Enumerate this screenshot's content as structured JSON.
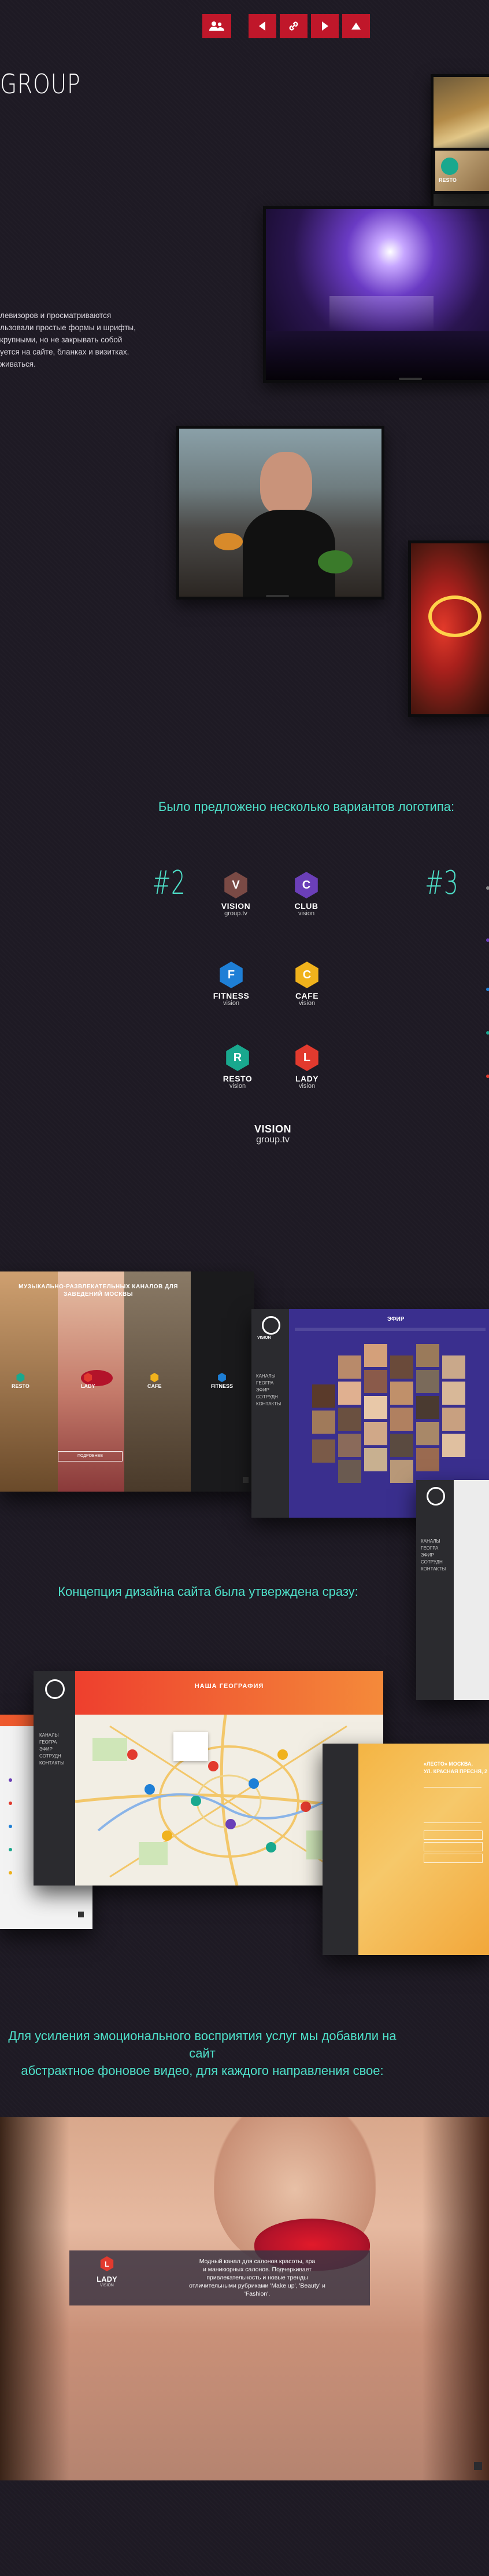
{
  "toolbar": {
    "people_icon": "people-icon",
    "prev_icon": "arrow-left-icon",
    "link_icon": "link-icon",
    "next_icon": "arrow-right-icon",
    "up_icon": "arrow-up-icon"
  },
  "header": {
    "brand": "GROUP"
  },
  "intro": {
    "lines": [
      "левизоров и просматриваются",
      "льзовали простые формы и шрифты,",
      "крупными, но не закрывать собой",
      "уется на сайте, бланках и визитках.",
      "живаться."
    ]
  },
  "tv_screens": {
    "small_tv_badge": "RESTO"
  },
  "logos": {
    "title": "Было  предложено несколько вариантов логотипа:",
    "variant_left": "#2",
    "variant_right": "#3",
    "items": [
      {
        "letter": "V",
        "name": "VISION",
        "sub": "group.tv",
        "color": "#7a4a45"
      },
      {
        "letter": "C",
        "name": "CLUB",
        "sub": "vision",
        "color": "#6b3fb8"
      },
      {
        "letter": "F",
        "name": "FITNESS",
        "sub": "vision",
        "color": "#1e7fd6"
      },
      {
        "letter": "C",
        "name": "CAFE",
        "sub": "vision",
        "color": "#f0b21c"
      },
      {
        "letter": "R",
        "name": "RESTO",
        "sub": "vision",
        "color": "#19a88e"
      },
      {
        "letter": "L",
        "name": "LADY",
        "sub": "vision",
        "color": "#e23a2e"
      }
    ],
    "wordmark_name": "VISION",
    "wordmark_sub": "group.tv"
  },
  "mockup1": {
    "heading": "МУЗЫКАЛЬНО-РАЗВЛЕКАТЕЛЬНЫХ КАНАЛОВ ДЛЯ ЗАВЕДЕНИЙ МОСКВЫ",
    "panels": [
      "RESTO",
      "LADY",
      "CAFE",
      "FITNESS"
    ],
    "button": "ПОДРОБНЕЕ"
  },
  "mockup2": {
    "logo": "VISION",
    "title": "ЭФИР",
    "nav": [
      "КАНАЛЫ",
      "ГЕОГРА",
      "ЭФИР",
      "СОТРУДН",
      "КОНТАКТЫ"
    ]
  },
  "concept": {
    "title": "Концепция дизайна сайта была утверждена сразу:"
  },
  "mockup3": {
    "title": "НАША ГЕОГРАФИЯ",
    "nav": [
      "КАНАЛЫ",
      "ГЕОГРА",
      "ЭФИР",
      "СОТРУДН",
      "КОНТАКТЫ"
    ]
  },
  "mockup4": {
    "lines": [
      "«ЛЕСТО» МОСКВА,",
      "УЛ. КРАСНАЯ ПРЕСНЯ, 2"
    ]
  },
  "video": {
    "title_lines": [
      "Для усиления эмоционального восприятия услуг мы добавили на сайт",
      "абстрактное фоновое видео, для каждого направления свое:"
    ],
    "logo_letter": "L",
    "logo_name": "LADY",
    "logo_sub": "VISION",
    "caption_lines": [
      "Модный канал для салонов красоты, spa",
      "и маникюрных салонов. Подчеркивает",
      "привлекательность и новые тренды",
      "отличительными рубриками 'Make up', 'Beauty' и",
      "'Fashion'."
    ]
  },
  "colors": {
    "bg": "#1e1a24",
    "accent_red": "#c0172a",
    "accent_teal": "#4ee0c9",
    "mock_orange": "#ee5a2e",
    "mock_purple": "#3a2f8e"
  }
}
